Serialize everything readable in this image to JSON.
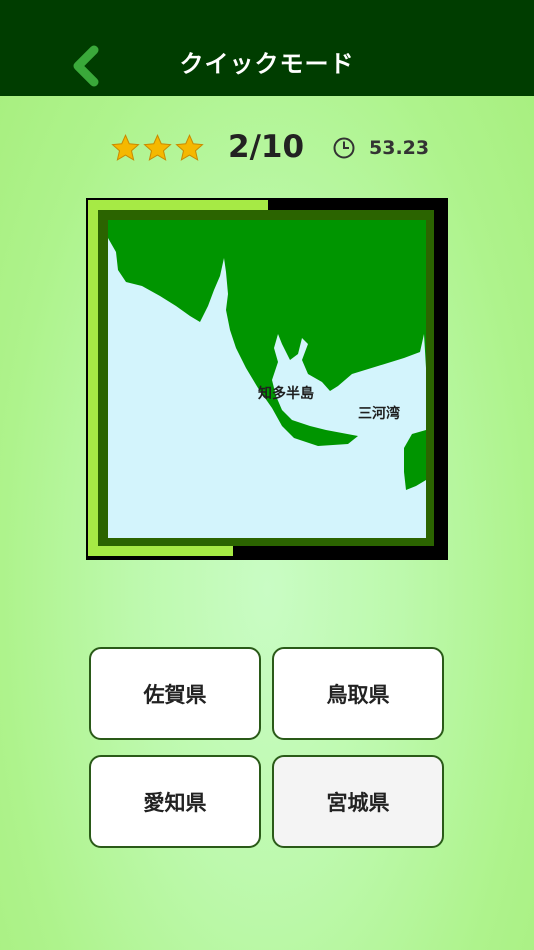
{
  "header": {
    "title": "クイックモード",
    "back_icon": "chevron-left-icon",
    "background": "#003d00"
  },
  "status": {
    "stars_earned": 3,
    "stars_total": 3,
    "star_color": "#f5b800",
    "progress": "2/10",
    "timer_icon": "clock-icon",
    "timer": "53.23"
  },
  "map": {
    "land_color": "#009500",
    "sea_color": "#d3f4fc",
    "labels": {
      "peninsula": "知多半島",
      "bay": "三河湾"
    }
  },
  "answers": [
    {
      "label": "佐賀県"
    },
    {
      "label": "鳥取県"
    },
    {
      "label": "愛知県"
    },
    {
      "label": "宮城県"
    }
  ]
}
